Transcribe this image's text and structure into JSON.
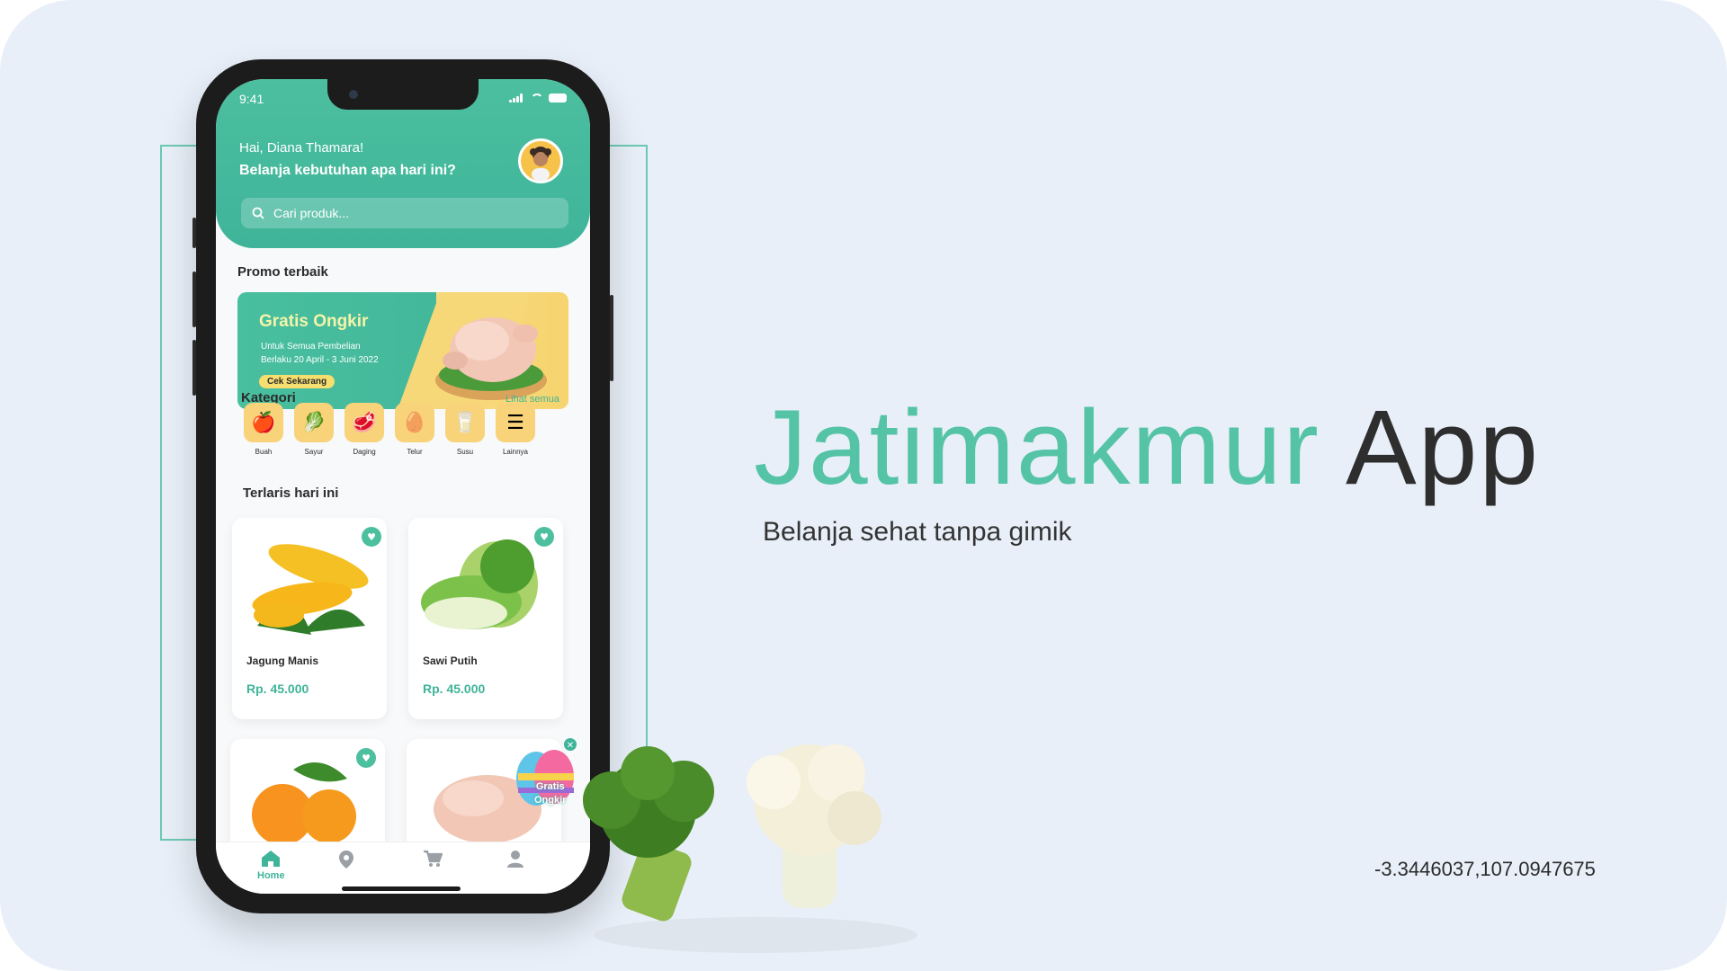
{
  "brand": {
    "name_accent": "Jatimakmur",
    "name_dark": "App",
    "tagline": "Belanja sehat tanpa gimik",
    "accent": "#55c3a6",
    "coordinates": "-3.3446037,107.0947675"
  },
  "status_bar": {
    "time": "9:41"
  },
  "header": {
    "greeting": "Hai, Diana Thamara!",
    "question": "Belanja kebutuhan apa hari ini?"
  },
  "search": {
    "placeholder": "Cari produk..."
  },
  "promo": {
    "section_title": "Promo terbaik",
    "title": "Gratis Ongkir",
    "subtitle": "Untuk Semua Pembelian",
    "date": "Berlaku 20 April - 3 Juni 2022",
    "button": "Cek Sekarang"
  },
  "categories": {
    "title": "Kategori",
    "see_all": "Lihat semua",
    "items": [
      {
        "label": "Buah",
        "icon": "fruit-basket-icon",
        "glyph": "🍎"
      },
      {
        "label": "Sayur",
        "icon": "vegetable-basket-icon",
        "glyph": "🥬"
      },
      {
        "label": "Daging",
        "icon": "meat-icon",
        "glyph": "🥩"
      },
      {
        "label": "Telur",
        "icon": "egg-basket-icon",
        "glyph": "🥚"
      },
      {
        "label": "Susu",
        "icon": "milk-carton-icon",
        "glyph": "🥛"
      },
      {
        "label": "Lainnya",
        "icon": "more-icon",
        "glyph": "☰"
      }
    ]
  },
  "bestseller": {
    "title": "Terlaris hari ini",
    "products": [
      {
        "name": "Jagung Manis",
        "price": "Rp. 45.000"
      },
      {
        "name": "Sawi Putih",
        "price": "Rp. 45.000"
      }
    ]
  },
  "floating_badge": {
    "line1": "Gratis",
    "line2": "Ongkir"
  },
  "tabbar": {
    "home": "Home"
  }
}
